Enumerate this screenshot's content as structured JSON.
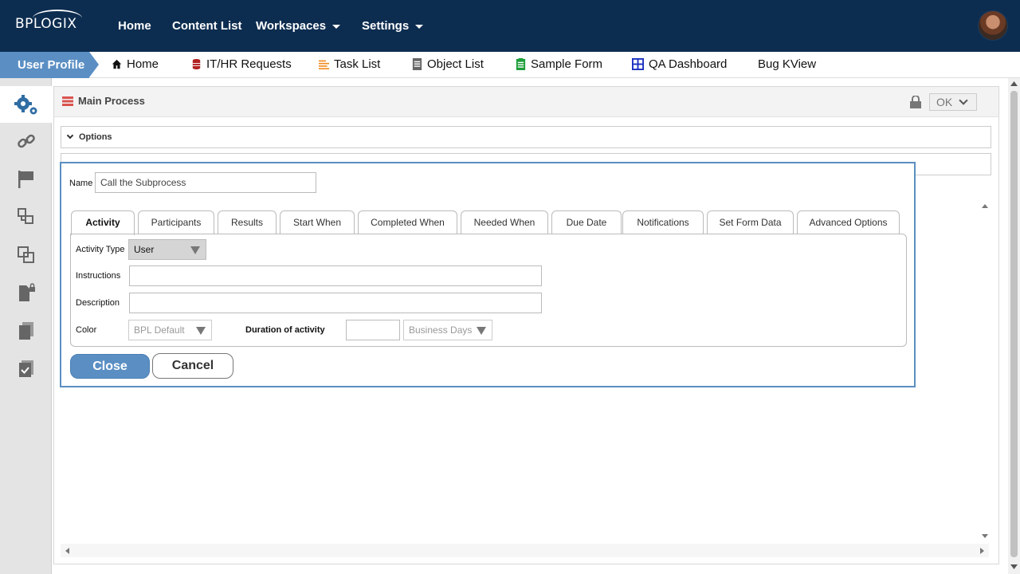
{
  "brand": {
    "logo": "BPLOGIX"
  },
  "topnav": {
    "items": [
      {
        "label": "Home"
      },
      {
        "label": "Content List"
      },
      {
        "label": "Workspaces"
      },
      {
        "label": "Settings"
      }
    ]
  },
  "nav2": {
    "user_profile": "User Profile",
    "items": [
      {
        "label": "Home",
        "icon": "home-icon"
      },
      {
        "label": "IT/HR Requests",
        "icon": "database-icon"
      },
      {
        "label": "Task List",
        "icon": "list-icon"
      },
      {
        "label": "Object List",
        "icon": "document-icon"
      },
      {
        "label": "Sample Form",
        "icon": "form-icon"
      },
      {
        "label": "QA Dashboard",
        "icon": "dashboard-icon"
      },
      {
        "label": "Bug KView",
        "icon": ""
      }
    ]
  },
  "panel": {
    "title": "Main Process",
    "ok_label": "OK",
    "accordion": {
      "options": "Options",
      "second": ""
    }
  },
  "dialog": {
    "name_label": "Name",
    "name_value": "Call the Subprocess",
    "tabs": [
      "Activity",
      "Participants",
      "Results",
      "Start When",
      "Completed When",
      "Needed When",
      "Due Date",
      "Notifications",
      "Set Form Data",
      "Advanced Options"
    ],
    "activity_type_label": "Activity Type",
    "activity_type_value": "User",
    "instructions_label": "Instructions",
    "instructions_value": "",
    "description_label": "Description",
    "description_value": "",
    "color_label": "Color",
    "color_value": "BPL Default",
    "duration_label": "Duration of activity",
    "duration_value": "",
    "duration_unit": "Business Days",
    "close_label": "Close",
    "cancel_label": "Cancel"
  },
  "colors": {
    "topbar": "#0d2d50",
    "accent": "#5b8fc4",
    "dialog_border": "#5a8fc0"
  }
}
